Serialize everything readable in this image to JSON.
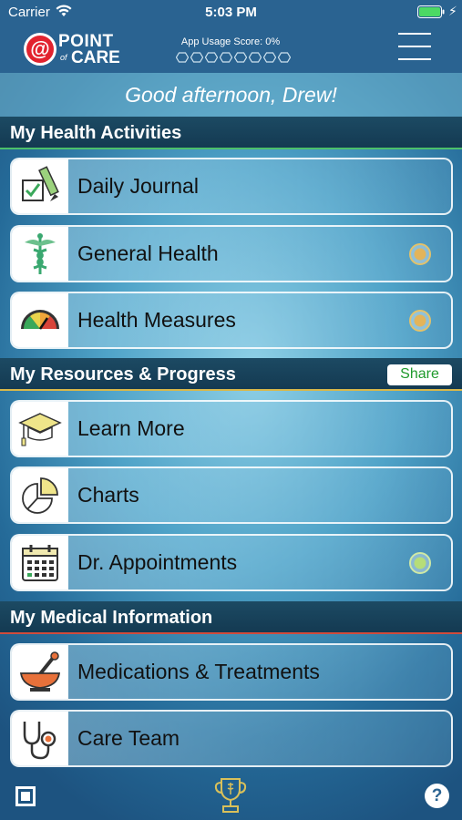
{
  "status_bar": {
    "carrier": "Carrier",
    "time": "5:03 PM"
  },
  "header": {
    "logo_at": "@",
    "logo_point": "POINT",
    "logo_of": "of",
    "logo_care": "CARE",
    "usage_score_label": "App Usage Score: 0%",
    "usage_hex_count": 8
  },
  "greeting": "Good afternoon, Drew!",
  "sections": {
    "health": {
      "title": "My Health Activities",
      "items": [
        {
          "label": "Daily Journal",
          "icon": "journal-icon",
          "indicator": null
        },
        {
          "label": "General Health",
          "icon": "caduceus-icon",
          "indicator": "gold"
        },
        {
          "label": "Health Measures",
          "icon": "gauge-icon",
          "indicator": "gold"
        }
      ]
    },
    "resources": {
      "title": "My Resources & Progress",
      "share_label": "Share",
      "items": [
        {
          "label": "Learn More",
          "icon": "graduation-cap-icon",
          "indicator": null
        },
        {
          "label": "Charts",
          "icon": "pie-chart-icon",
          "indicator": null
        },
        {
          "label": "Dr. Appointments",
          "icon": "calendar-icon",
          "indicator": "green"
        }
      ]
    },
    "medical": {
      "title": "My Medical Information",
      "items": [
        {
          "label": "Medications & Treatments",
          "icon": "mortar-pestle-icon",
          "indicator": null
        },
        {
          "label": "Care Team",
          "icon": "stethoscope-icon",
          "indicator": null
        }
      ]
    }
  },
  "footer": {
    "help_label": "?"
  },
  "colors": {
    "header_bg": "#2a6391",
    "section_bg": "#143a52",
    "health_accent": "#4cc06a",
    "resources_accent": "#d9b84a",
    "medical_accent": "#d04b3c",
    "share_text": "#1f9a2c"
  }
}
